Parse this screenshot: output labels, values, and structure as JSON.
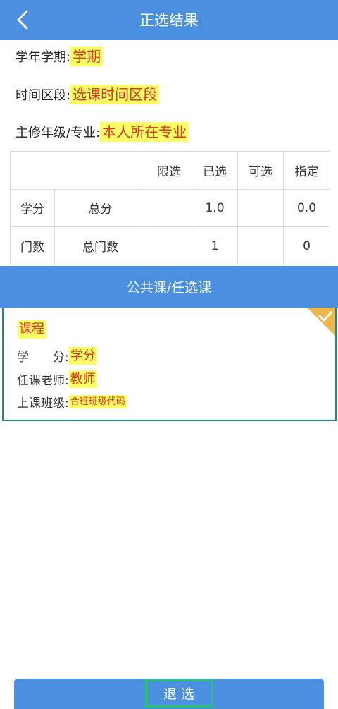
{
  "header": {
    "title": "正选结果"
  },
  "info": {
    "term_label": "学年学期:",
    "term_value": "学期",
    "period_label": "时间区段:",
    "period_value": "选课时间区段",
    "major_label": "主修年级/专业:",
    "major_value": "本人所在专业"
  },
  "summary_table": {
    "columns": [
      "",
      "",
      "限选",
      "已选",
      "可选",
      "指定"
    ],
    "rows": [
      [
        "学分",
        "总分",
        "",
        "1.0",
        "",
        "0.0"
      ],
      [
        "门数",
        "总门数",
        "",
        "1",
        "",
        "0"
      ]
    ]
  },
  "section": {
    "title": "公共课/任选课"
  },
  "course": {
    "name": "课程",
    "credit_label": "学　　分:",
    "credit_value": "学分",
    "teacher_label": "任课老师:",
    "teacher_value": "教师",
    "class_label": "上课班级:",
    "class_value": "合班班级代码",
    "selected": true
  },
  "footer": {
    "drop_label": "退选"
  },
  "colors": {
    "primary": "#4a8fe0",
    "highlight": "#ffff66",
    "highlight_text": "#e0301e",
    "card_border": "#1f8a80",
    "check_corner": "#f0b84a"
  }
}
